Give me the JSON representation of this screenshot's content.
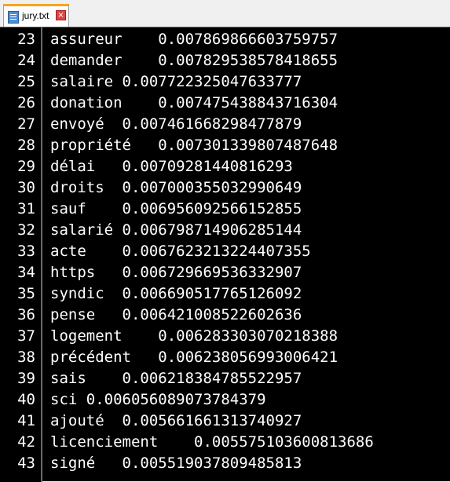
{
  "tab": {
    "filename": "jury.txt",
    "close_glyph": "×"
  },
  "lines": [
    {
      "n": "23",
      "text": "assureur    0.007869866603759757"
    },
    {
      "n": "24",
      "text": "demander    0.007829538578418655"
    },
    {
      "n": "25",
      "text": "salaire 0.007722325047633777"
    },
    {
      "n": "26",
      "text": "donation    0.007475438843716304"
    },
    {
      "n": "27",
      "text": "envoyé  0.007461668298477879"
    },
    {
      "n": "28",
      "text": "propriété   0.007301339807487648"
    },
    {
      "n": "29",
      "text": "délai   0.00709281440816293"
    },
    {
      "n": "30",
      "text": "droits  0.007000355032990649"
    },
    {
      "n": "31",
      "text": "sauf    0.006956092566152855"
    },
    {
      "n": "32",
      "text": "salarié 0.006798714906285144"
    },
    {
      "n": "33",
      "text": "acte    0.0067623213224407355"
    },
    {
      "n": "34",
      "text": "https   0.006729669536332907"
    },
    {
      "n": "35",
      "text": "syndic  0.006690517765126092"
    },
    {
      "n": "36",
      "text": "pense   0.006421008522602636"
    },
    {
      "n": "37",
      "text": "logement    0.006283303070218388"
    },
    {
      "n": "38",
      "text": "précédent   0.006238056993006421"
    },
    {
      "n": "39",
      "text": "sais    0.006218384785522957"
    },
    {
      "n": "40",
      "text": "sci 0.006056089073784379"
    },
    {
      "n": "41",
      "text": "ajouté  0.005661661313740927"
    },
    {
      "n": "42",
      "text": "licenciement    0.005575103600813686"
    },
    {
      "n": "43",
      "text": "signé   0.005519037809485813"
    }
  ],
  "colors": {
    "editor_background": "#000000",
    "text": "#ffffff",
    "tab_accent": "#f5a623",
    "close_button": "#e04343"
  }
}
